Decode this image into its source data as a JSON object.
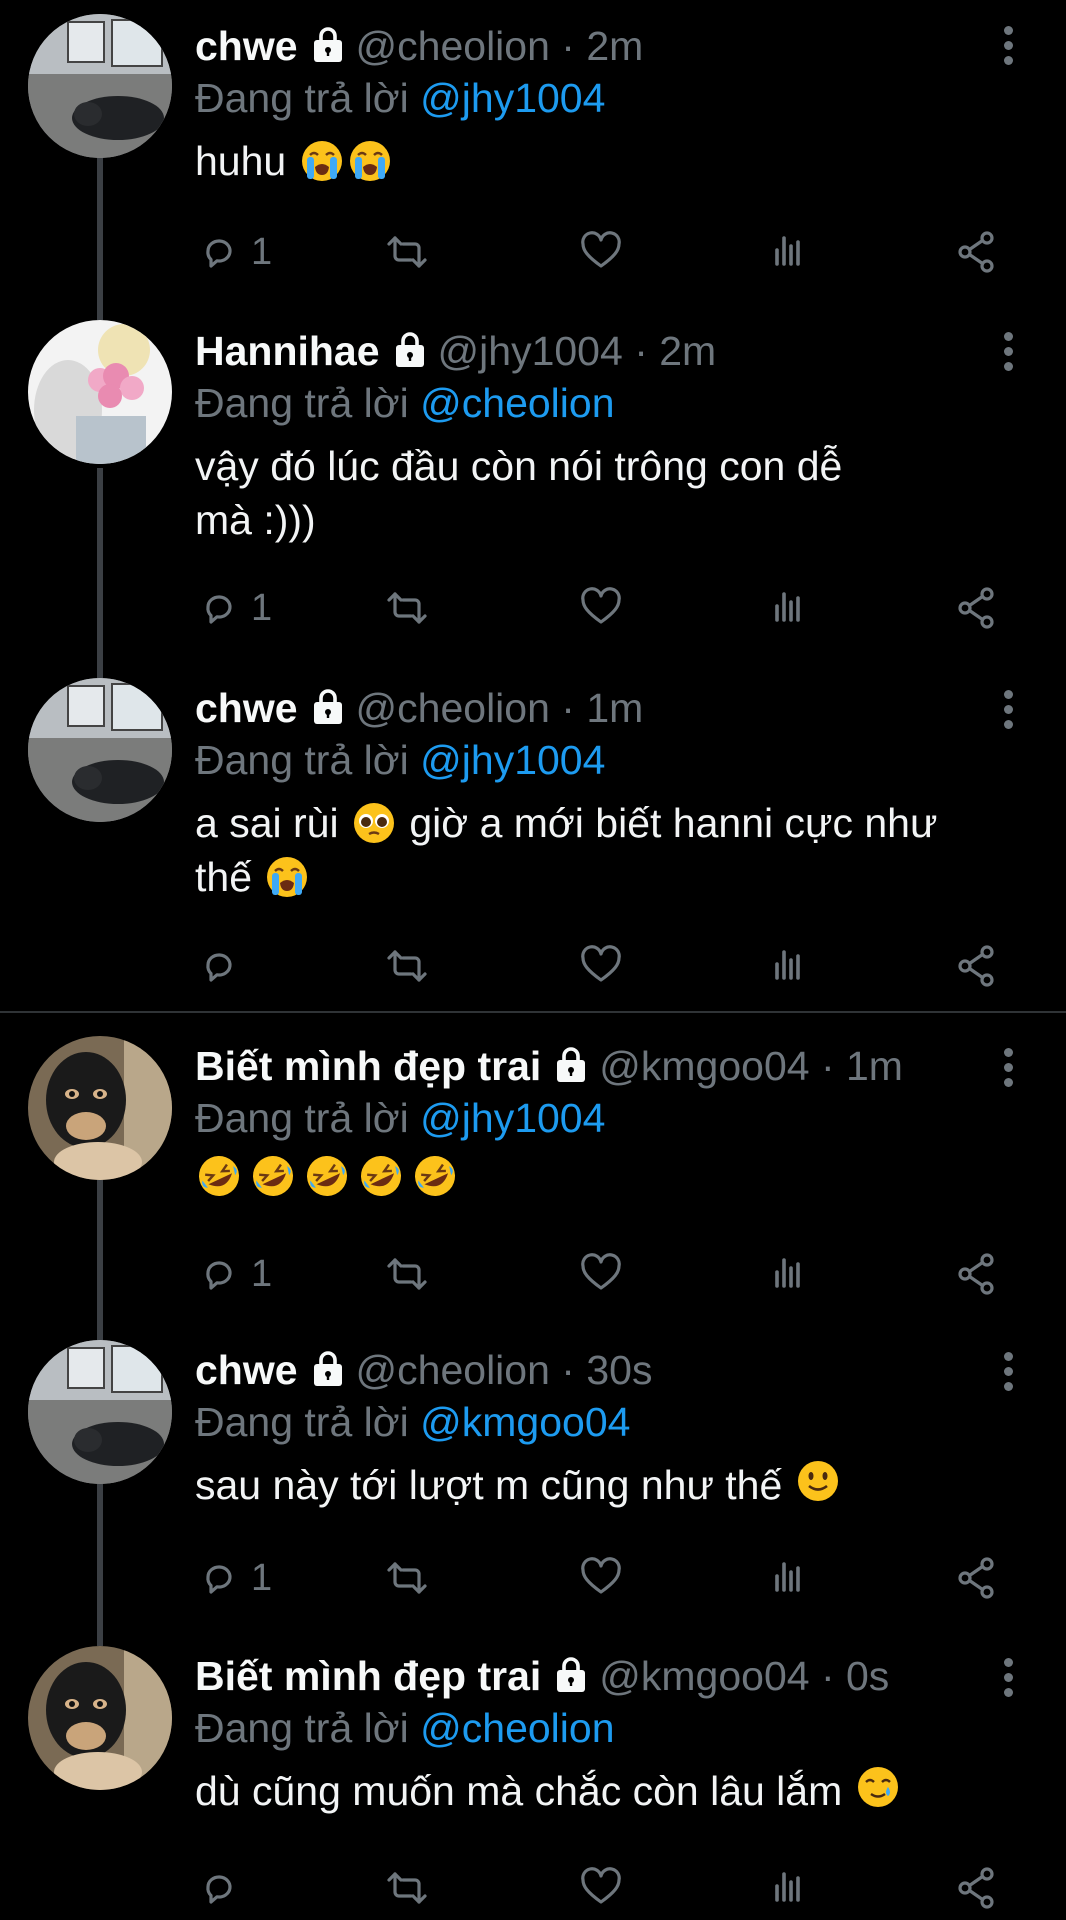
{
  "reply_prefix": "Đang trả lời",
  "colors": {
    "background": "#000000",
    "mention": "#1d9bf0",
    "muted": "#6e767d",
    "text": "#e7e9ea",
    "thread_line": "#3b3f44"
  },
  "tweets": [
    {
      "name": "chwe",
      "handle": "@cheolion",
      "time": "2m",
      "reply_to": "@jhy1004",
      "text_lines": [
        "huhu"
      ],
      "emojis": [
        "loudly-crying-face",
        "loudly-crying-face"
      ],
      "reply_count": "1",
      "avatar": "avatar-chwe"
    },
    {
      "name": "Hannihae",
      "handle": "@jhy1004",
      "time": "2m",
      "reply_to": "@cheolion",
      "text_lines": [
        "vậy đó lúc đầu còn nói trông con dễ",
        "mà :)))"
      ],
      "reply_count": "1",
      "avatar": "avatar-hannihae"
    },
    {
      "name": "chwe",
      "handle": "@cheolion",
      "time": "1m",
      "reply_to": "@jhy1004",
      "text_parts": [
        "a sai rùi",
        "giờ a mới biết hanni cực như",
        "thế"
      ],
      "emojis": [
        "pleading-face",
        "loudly-crying-face"
      ],
      "reply_count": "",
      "avatar": "avatar-chwe"
    },
    {
      "name": "Biết mình đẹp trai",
      "handle": "@kmgoo04",
      "time": "1m",
      "reply_to": "@jhy1004",
      "text_lines": [
        ""
      ],
      "emojis": [
        "rolling-on-floor-laughing",
        "rolling-on-floor-laughing",
        "rolling-on-floor-laughing",
        "rolling-on-floor-laughing",
        "rolling-on-floor-laughing"
      ],
      "reply_count": "1",
      "avatar": "avatar-kmgoo"
    },
    {
      "name": "chwe",
      "handle": "@cheolion",
      "time": "30s",
      "reply_to": "@kmgoo04",
      "text_lines": [
        "sau này tới lượt m cũng như thế"
      ],
      "emojis": [
        "slightly-smiling-face"
      ],
      "reply_count": "1",
      "avatar": "avatar-chwe"
    },
    {
      "name": "Biết mình đẹp trai",
      "handle": "@kmgoo04",
      "time": "0s",
      "reply_to": "@cheolion",
      "text_lines": [
        "dù cũng muốn mà chắc còn lâu lắm"
      ],
      "emojis": [
        "smiling-face-with-tear"
      ],
      "reply_count": "",
      "avatar": "avatar-kmgoo"
    }
  ],
  "icons": [
    "reply-icon",
    "retweet-icon",
    "like-icon",
    "views-icon",
    "share-icon",
    "lock-icon",
    "more-icon"
  ]
}
